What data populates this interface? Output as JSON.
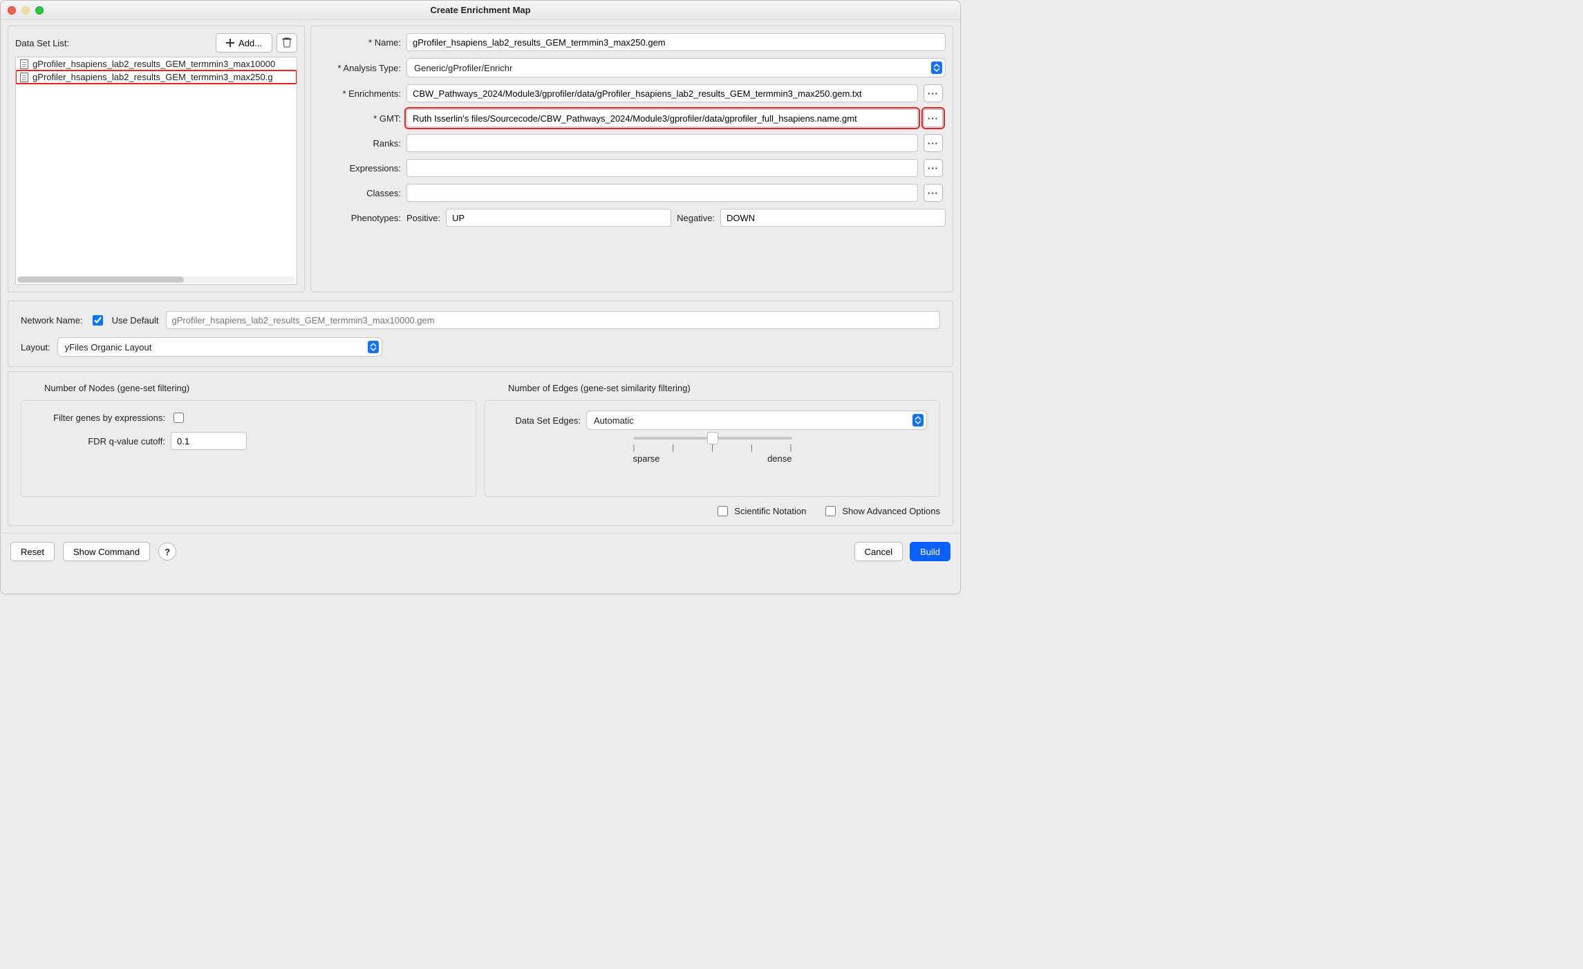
{
  "window": {
    "title": "Create Enrichment Map"
  },
  "dataSetList": {
    "label": "Data Set List:",
    "addButton": "Add...",
    "items": [
      {
        "name": "gProfiler_hsapiens_lab2_results_GEM_termmin3_max10000"
      },
      {
        "name": "gProfiler_hsapiens_lab2_results_GEM_termmin3_max250.g"
      }
    ],
    "selectedIndex": 1
  },
  "form": {
    "nameLabel": "* Name:",
    "nameValue": "gProfiler_hsapiens_lab2_results_GEM_termmin3_max250.gem",
    "analysisTypeLabel": "* Analysis Type:",
    "analysisTypeValue": "Generic/gProfiler/Enrichr",
    "enrichmentsLabel": "* Enrichments:",
    "enrichmentsValue": "CBW_Pathways_2024/Module3/gprofiler/data/gProfiler_hsapiens_lab2_results_GEM_termmin3_max250.gem.txt",
    "gmtLabel": "* GMT:",
    "gmtValue": "Ruth Isserlin's files/Sourcecode/CBW_Pathways_2024/Module3/gprofiler/data/gprofiler_full_hsapiens.name.gmt",
    "ranksLabel": "Ranks:",
    "ranksValue": "",
    "expressionsLabel": "Expressions:",
    "expressionsValue": "",
    "classesLabel": "Classes:",
    "classesValue": "",
    "phenotypesLabel": "Phenotypes:",
    "positiveLabel": "Positive:",
    "positiveValue": "UP",
    "negativeLabel": "Negative:",
    "negativeValue": "DOWN"
  },
  "network": {
    "nameLabel": "Network Name:",
    "useDefaultLabel": "Use Default",
    "useDefaultChecked": true,
    "placeholder": "gProfiler_hsapiens_lab2_results_GEM_termmin3_max10000.gem",
    "layoutLabel": "Layout:",
    "layoutValue": "yFiles Organic Layout"
  },
  "filtering": {
    "nodes": {
      "title": "Number of Nodes (gene-set filtering)",
      "filterGenesLabel": "Filter genes by expressions:",
      "filterGenesChecked": false,
      "fdrLabel": "FDR q-value cutoff:",
      "fdrValue": "0.1"
    },
    "edges": {
      "title": "Number of Edges (gene-set similarity filtering)",
      "dataSetEdgesLabel": "Data Set Edges:",
      "dataSetEdgesValue": "Automatic",
      "sparseLabel": "sparse",
      "denseLabel": "dense"
    },
    "scientificNotation": "Scientific Notation",
    "showAdvanced": "Show Advanced Options"
  },
  "footer": {
    "reset": "Reset",
    "showCommand": "Show Command",
    "cancel": "Cancel",
    "build": "Build"
  }
}
